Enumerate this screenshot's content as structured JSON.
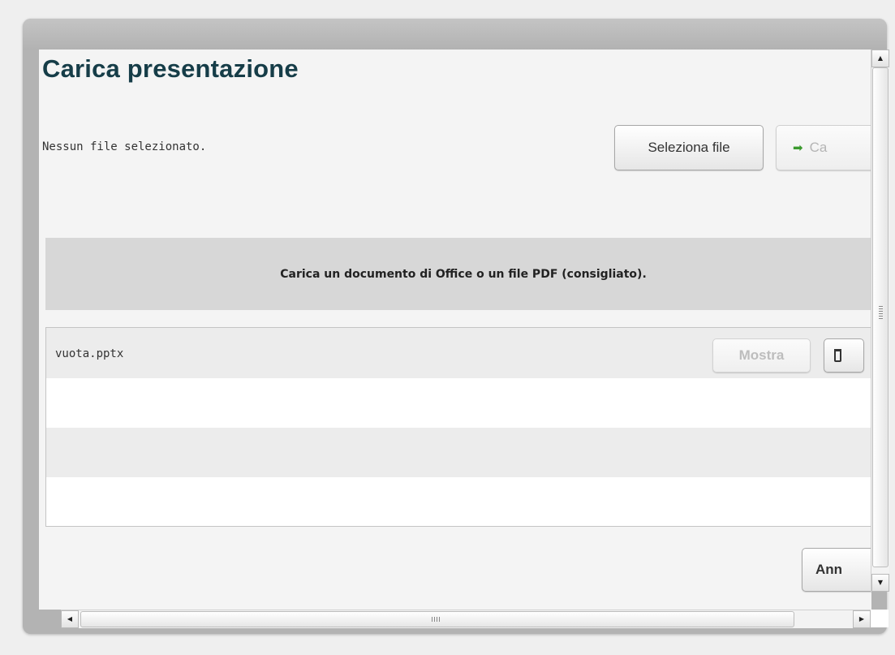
{
  "dialog": {
    "title": "Carica presentazione",
    "status_text": "Nessun file selezionato.",
    "select_button_label": "Seleziona file",
    "upload_button_label": "Ca",
    "info_text": "Carica un documento di Office o un file PDF (consigliato).",
    "cancel_button_label": "Ann"
  },
  "files": [
    {
      "name": "vuota.pptx",
      "show_label": "Mostra"
    }
  ],
  "icons": {
    "upload": "arrow-right-icon",
    "delete": "trash-icon",
    "scroll_up": "triangle-up-icon",
    "scroll_down": "triangle-down-icon",
    "scroll_left": "triangle-left-icon",
    "scroll_right": "triangle-right-icon"
  },
  "colors": {
    "title": "#163d48",
    "upload_arrow": "#3b9a2e",
    "info_band": "#d7d7d7"
  }
}
